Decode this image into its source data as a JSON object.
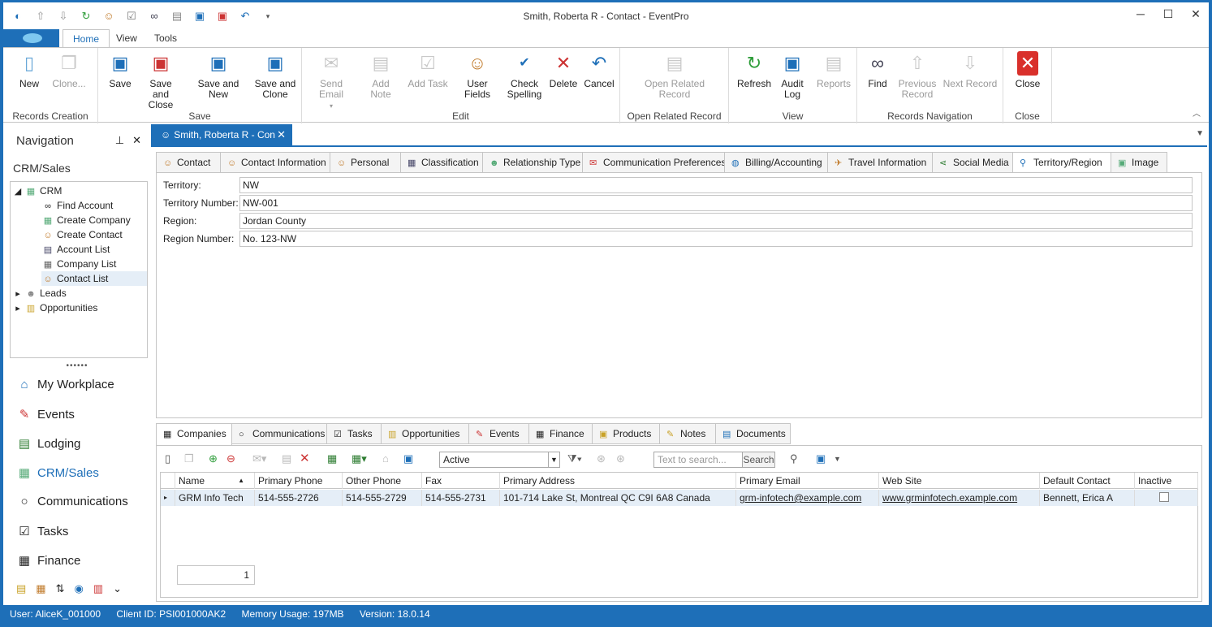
{
  "window": {
    "title": "Smith, Roberta R - Contact - EventPro",
    "minimize": "─",
    "maximize": "☐",
    "close": "✕"
  },
  "qat": [
    "refresh-circle-icon",
    "up-arrow-icon",
    "down-arrow-icon",
    "reload-icon",
    "user-edit-icon",
    "checklist-icon",
    "binoculars-icon",
    "note-icon",
    "save-icon",
    "save-close-icon",
    "undo-icon",
    "dropdown-icon"
  ],
  "ribbon_tabs": [
    "Home",
    "View",
    "Tools"
  ],
  "ribbon": {
    "groups": {
      "records_creation": "Records Creation",
      "save": "Save",
      "edit": "Edit",
      "open_related": "Open Related Record",
      "view": "View",
      "records_navigation": "Records Navigation",
      "close": "Close"
    },
    "buttons": {
      "new": "New",
      "clone": "Clone...",
      "save": "Save",
      "save_close_1": "Save and",
      "save_close_2": "Close",
      "save_new": "Save and New",
      "save_clone_1": "Save and",
      "save_clone_2": "Clone",
      "send_email": "Send Email",
      "add_note": "Add Note",
      "add_task": "Add Task",
      "user_fields": "User Fields",
      "check_spelling_1": "Check",
      "check_spelling_2": "Spelling",
      "delete": "Delete",
      "cancel": "Cancel",
      "open_related_1": "Open Related",
      "open_related_2": "Record",
      "refresh": "Refresh",
      "audit_log_1": "Audit",
      "audit_log_2": "Log",
      "reports": "Reports",
      "find": "Find",
      "previous_1": "Previous",
      "previous_2": "Record",
      "next": "Next Record",
      "close": "Close"
    }
  },
  "navigation": {
    "title": "Navigation",
    "section": "CRM/Sales",
    "tree": {
      "crm": "CRM",
      "find_account": "Find Account",
      "create_company": "Create Company",
      "create_contact": "Create Contact",
      "account_list": "Account List",
      "company_list": "Company List",
      "contact_list": "Contact List",
      "leads": "Leads",
      "opportunities": "Opportunities"
    },
    "grip": "••••••",
    "items": {
      "my_workplace": "My Workplace",
      "events": "Events",
      "lodging": "Lodging",
      "crm_sales": "CRM/Sales",
      "communications": "Communications",
      "tasks": "Tasks",
      "finance": "Finance"
    }
  },
  "document": {
    "tab_title": "Smith, Roberta R - Con",
    "tabs": [
      "Contact",
      "Contact Information",
      "Personal",
      "Classification",
      "Relationship Type",
      "Communication Preferences",
      "Billing/Accounting",
      "Travel Information",
      "Social Media",
      "Territory/Region",
      "Image"
    ],
    "fields": {
      "territory_label": "Territory:",
      "territory_value": "NW",
      "territory_number_label": "Territory Number:",
      "territory_number_value": "NW-001",
      "region_label": "Region:",
      "region_value": "Jordan County",
      "region_number_label": "Region Number:",
      "region_number_value": "No. 123-NW"
    },
    "bottom_tabs": [
      "Companies",
      "Communications",
      "Tasks",
      "Opportunities",
      "Events",
      "Finance",
      "Products",
      "Notes",
      "Documents"
    ],
    "filter": {
      "status": "Active",
      "search_placeholder": "Text to search...",
      "search_button": "Search"
    },
    "grid": {
      "columns": [
        "Name",
        "Primary Phone",
        "Other Phone",
        "Fax",
        "Primary Address",
        "Primary Email",
        "Web Site",
        "Default Contact",
        "Inactive"
      ],
      "rows": [
        [
          "GRM Info Tech",
          "514-555-2726",
          "514-555-2729",
          "514-555-2731",
          "101-714 Lake St, Montreal QC C9I 6A8 Canada",
          "grm-infotech@example.com",
          "www.grminfotech.example.com",
          "Bennett, Erica A",
          ""
        ]
      ],
      "footer_count": "1"
    }
  },
  "status": {
    "user": "User: AliceK_001000",
    "client": "Client ID: PSI001000AK2",
    "memory": "Memory Usage: 197MB",
    "version": "Version: 18.0.14"
  }
}
